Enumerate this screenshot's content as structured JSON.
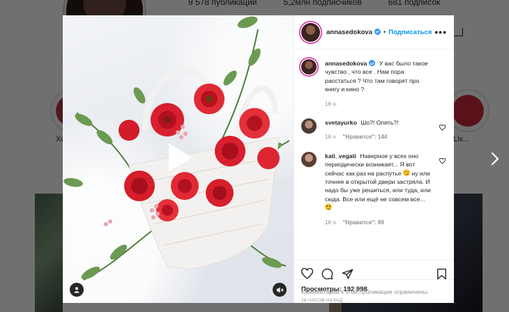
{
  "background": {
    "stats": {
      "posts": "9 578 публикаций",
      "followers": "5,2млн подписчиков",
      "following": "681 подписок"
    },
    "highlight_left_label": "Хо",
    "highlight_right_label": "ка Liv..."
  },
  "post": {
    "author": "annasedokova",
    "follow_label": "Подписаться",
    "caption": "У вас было такое чувство , что все . Нам пора расстаться ? Что там говорят про книгу и кино ?",
    "caption_time": "16 ч.",
    "comments": [
      {
        "user": "svetayurko",
        "text": "Шо?! Опять?!",
        "time": "16 ч.",
        "likes": "\"Нравится\": 144"
      },
      {
        "user": "kati_vegati",
        "text_1": "Наверное у всех оно периодически возникает... Я вот сейчас как раз на распутье",
        "text_2": "ну или точнее в открытой двери застряла. И надо бы уже решиться, или туда, или сюда. Все или ещё не совсем все...",
        "time": "16 ч.",
        "likes": "\"Нравится\": 89"
      }
    ],
    "views_label": "Просмотры:",
    "views_count": "192 998",
    "posted_ago": "16 ЧАСОВ НАЗАД",
    "comments_restricted": "Комментарии к этой публикации ограничены."
  },
  "icons": {
    "like": "heart-icon",
    "comment": "comment-icon",
    "share": "share-icon",
    "save": "bookmark-icon",
    "play": "play-icon",
    "tag": "user-tag-icon",
    "mute": "mute-icon",
    "next": "chevron-right-icon"
  },
  "colors": {
    "accent": "#0095f6",
    "verified": "#3897f0",
    "muted_text": "#8e8e8e"
  }
}
